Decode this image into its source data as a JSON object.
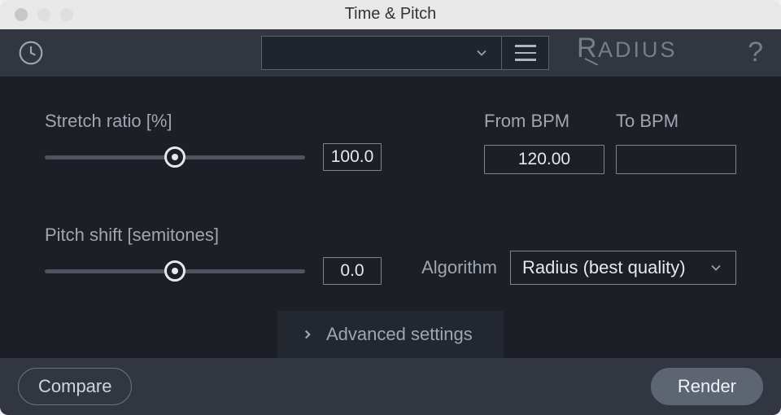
{
  "window": {
    "title": "Time & Pitch"
  },
  "toolbar": {
    "brand": "RADIUS",
    "help_symbol": "?",
    "preset_value": ""
  },
  "stretch": {
    "label": "Stretch ratio [%]",
    "value": "100.0"
  },
  "bpm": {
    "from_label": "From BPM",
    "from_value": "120.00",
    "to_label": "To BPM",
    "to_value": ""
  },
  "pitch": {
    "label": "Pitch shift [semitones]",
    "value": "0.0"
  },
  "algorithm": {
    "label": "Algorithm",
    "selected": "Radius (best quality)"
  },
  "advanced": {
    "label": "Advanced settings"
  },
  "footer": {
    "compare_label": "Compare",
    "render_label": "Render"
  }
}
